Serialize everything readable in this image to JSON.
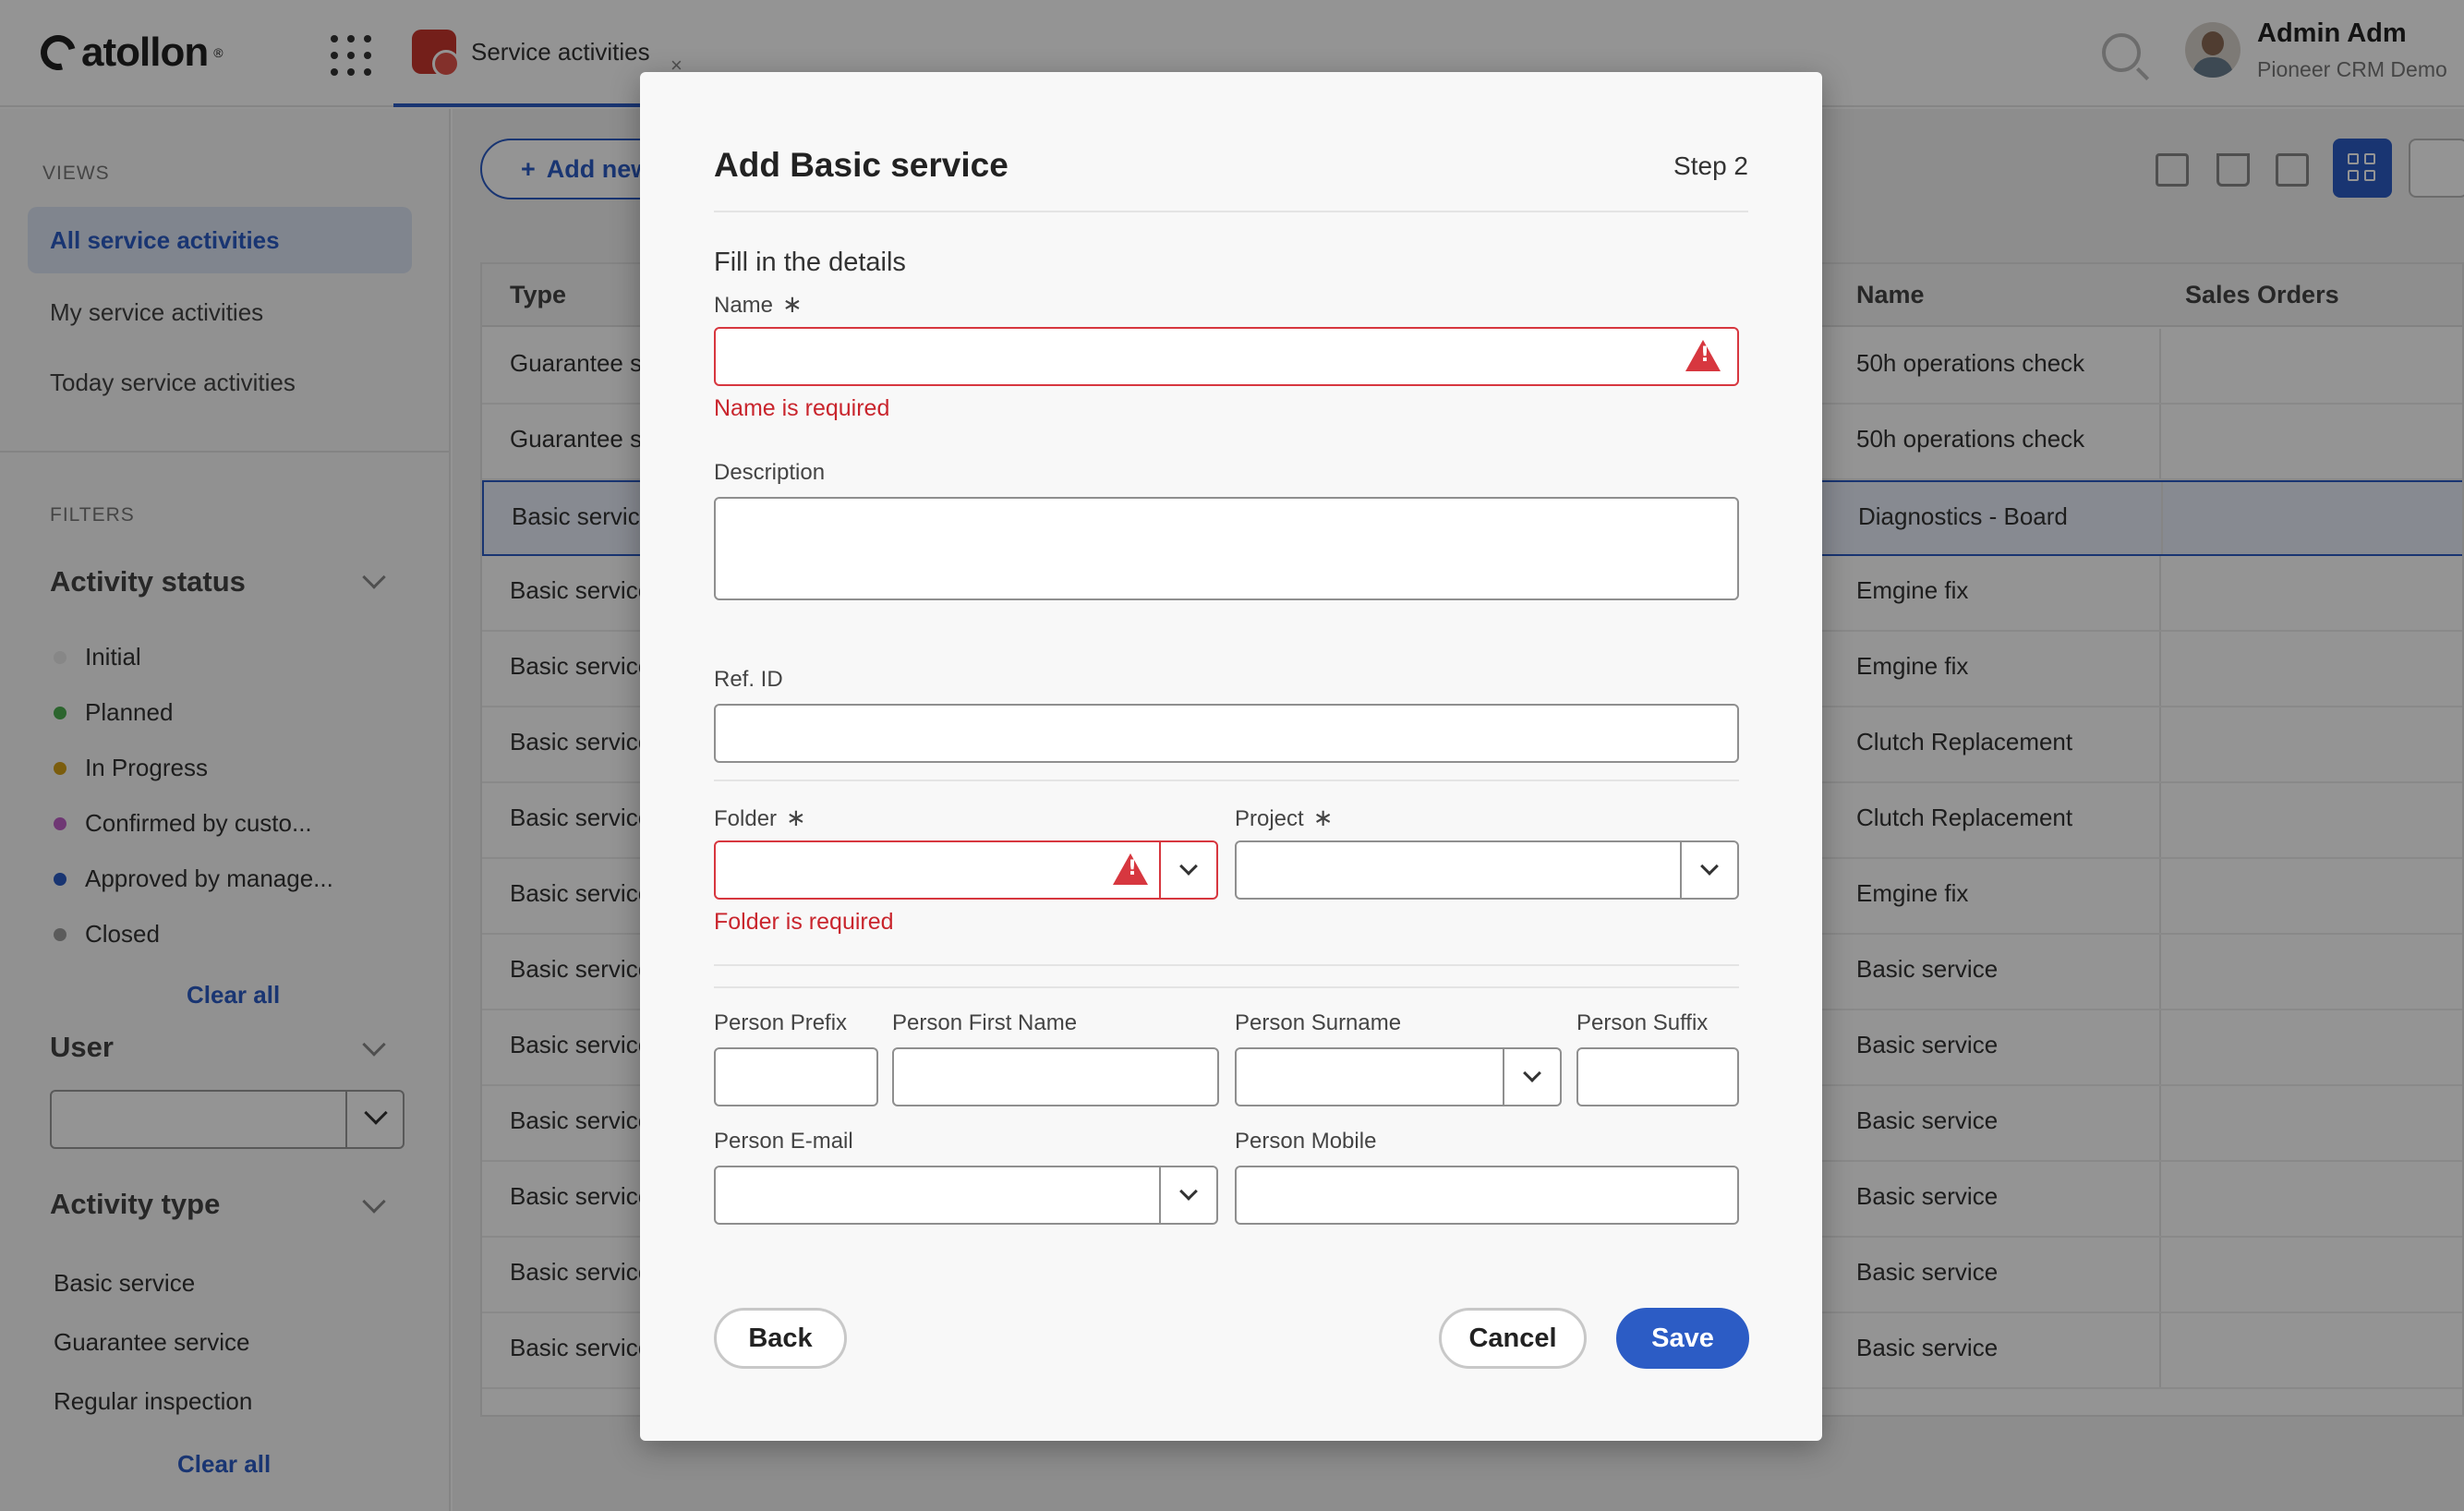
{
  "header": {
    "logo_text": "atollon",
    "logo_reg": "®",
    "app_tab_label": "Service activities",
    "app_tab_close": "×",
    "user_name": "Admin Adm",
    "user_org": "Pioneer CRM Demo"
  },
  "sidebar": {
    "views_heading": "VIEWS",
    "views": [
      {
        "label": "All service activities",
        "active": true
      },
      {
        "label": "My service activities",
        "active": false
      },
      {
        "label": "Today service activities",
        "active": false
      }
    ],
    "filters_heading": "FILTERS",
    "activity_status": {
      "title": "Activity status",
      "items": [
        {
          "label": "Initial",
          "color": "#e8e8e8"
        },
        {
          "label": "Planned",
          "color": "#4caf50"
        },
        {
          "label": "In Progress",
          "color": "#d4a017"
        },
        {
          "label": "Confirmed by custo...",
          "color": "#c060c8"
        },
        {
          "label": "Approved by manage...",
          "color": "#2c5cc5"
        },
        {
          "label": "Closed",
          "color": "#9e9e9e"
        }
      ],
      "clear_label": "Clear all"
    },
    "user_filter": {
      "title": "User",
      "value": ""
    },
    "activity_type": {
      "title": "Activity type",
      "items": [
        "Basic service",
        "Guarantee service",
        "Regular inspection"
      ],
      "clear_label": "Clear all"
    }
  },
  "toolbar": {
    "add_new_label": "Add new"
  },
  "table": {
    "columns": {
      "type": "Type",
      "name": "Name",
      "sales_orders": "Sales Orders"
    },
    "rows": [
      {
        "type": "Guarantee se",
        "name": "50h operations check"
      },
      {
        "type": "Guarantee se",
        "name": "50h operations check"
      },
      {
        "type": "Basic service",
        "name": "Diagnostics - Board",
        "selected": true
      },
      {
        "type": "Basic service",
        "name": "Emgine fix"
      },
      {
        "type": "Basic service",
        "name": "Emgine fix"
      },
      {
        "type": "Basic service",
        "name": "Clutch Replacement"
      },
      {
        "type": "Basic service",
        "name": "Clutch Replacement"
      },
      {
        "type": "Basic service",
        "name": "Emgine fix"
      },
      {
        "type": "Basic service",
        "name": "Basic service"
      },
      {
        "type": "Basic service",
        "name": "Basic service"
      },
      {
        "type": "Basic service",
        "name": "Basic service"
      },
      {
        "type": "Basic service",
        "name": "Basic service"
      },
      {
        "type": "Basic service",
        "name": "Basic service"
      },
      {
        "type": "Basic service",
        "name": "Basic service"
      }
    ]
  },
  "modal": {
    "title": "Add Basic service",
    "step": "Step 2",
    "subtitle": "Fill in the details",
    "required_mark": "∗",
    "name": {
      "label": "Name",
      "value": "",
      "error": "Name is required"
    },
    "description": {
      "label": "Description",
      "value": ""
    },
    "ref_id": {
      "label": "Ref. ID",
      "value": ""
    },
    "folder": {
      "label": "Folder",
      "value": "",
      "error": "Folder is required"
    },
    "project": {
      "label": "Project",
      "value": ""
    },
    "person_prefix": {
      "label": "Person Prefix",
      "value": ""
    },
    "person_first_name": {
      "label": "Person First Name",
      "value": ""
    },
    "person_surname": {
      "label": "Person Surname",
      "value": ""
    },
    "person_suffix": {
      "label": "Person Suffix",
      "value": ""
    },
    "person_email": {
      "label": "Person E-mail",
      "value": ""
    },
    "person_mobile": {
      "label": "Person Mobile",
      "value": ""
    },
    "buttons": {
      "back": "Back",
      "cancel": "Cancel",
      "save": "Save"
    }
  }
}
